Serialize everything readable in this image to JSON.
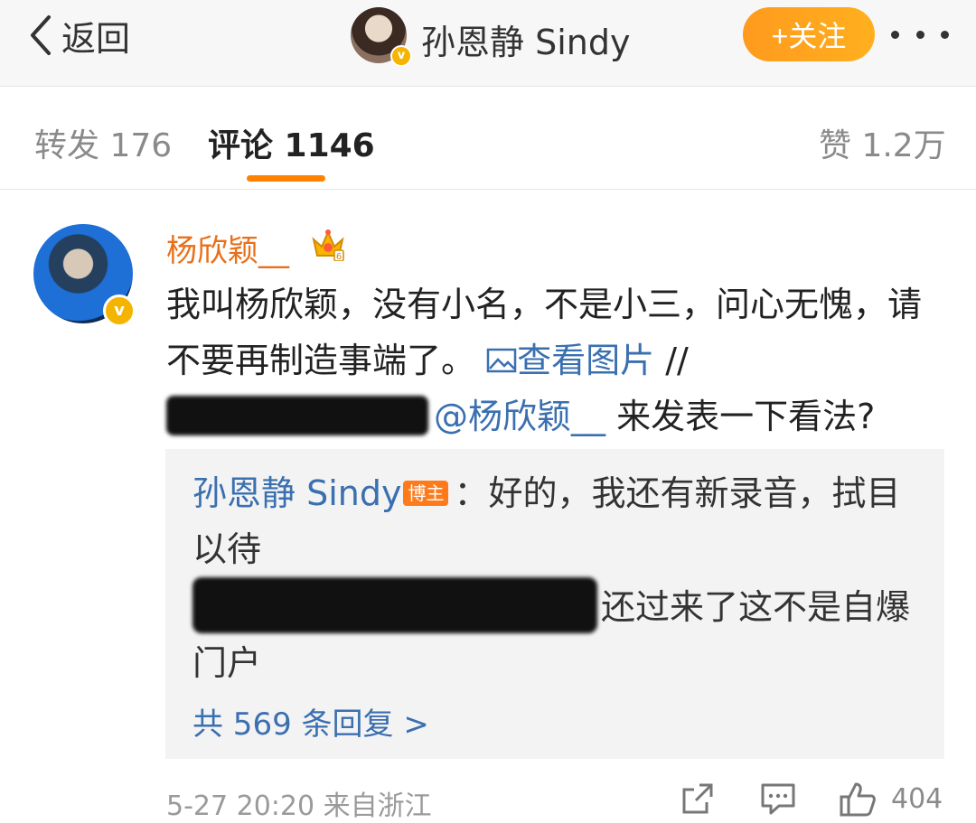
{
  "header": {
    "back_label": "返回",
    "blog_name": "孙恩静 Sindy",
    "follow_label": "+关注",
    "accent_color": "#ff8200"
  },
  "tabs": {
    "repost": "转发 176",
    "comment": "评论 1146",
    "like": "赞 1.2万"
  },
  "comment": {
    "user": "杨欣颖__",
    "text_part1": "我叫杨欣颖，没有小名，不是小三，问心无愧，请不要再制造事端了。",
    "view_image": "查看图片",
    "sep": " //",
    "mention": "@杨欣颖__",
    "text_part2": " 来发表一下看法?",
    "time": "5-27 20:20  来自浙江",
    "like_count": "404"
  },
  "reply": {
    "author": "孙恩静 Sindy",
    "badge": "博主",
    "colon": "：",
    "text": "好的，我还有新录音，拭目以待",
    "text2": "还过来了这不是自爆门户",
    "more": "共 569 条回复 >"
  },
  "icons": {
    "back": "chevron-left-icon",
    "more": "more-dots-icon",
    "crown": "crown-icon",
    "image": "image-icon",
    "share": "share-icon",
    "comment": "comment-icon",
    "like": "thumbs-up-icon"
  }
}
